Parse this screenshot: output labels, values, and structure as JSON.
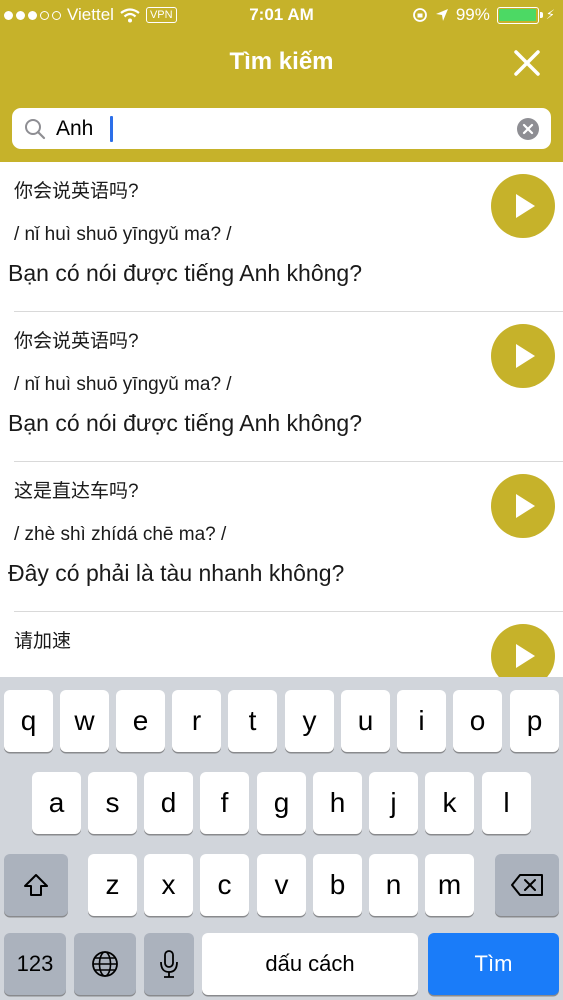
{
  "status_bar": {
    "carrier": "Viettel",
    "vpn": "VPN",
    "time": "7:01 AM",
    "battery": "99%",
    "battery_level": 0.99,
    "icons": [
      "signal-dots",
      "wifi-icon",
      "vpn-badge",
      "orientation-lock-icon",
      "location-arrow-icon",
      "battery-icon",
      "charging-bolt-icon"
    ]
  },
  "header": {
    "title": "Tìm kiếm",
    "close_icon": "close-icon"
  },
  "search": {
    "value": "Anh",
    "search_icon": "search-icon",
    "clear_icon": "clear-icon"
  },
  "results": [
    {
      "chinese": "你会说英语吗?",
      "pinyin": "/ nǐ huì shuō yīngyǔ ma? /",
      "vietnamese": "Bạn có nói được tiếng Anh không?"
    },
    {
      "chinese": "你会说英语吗?",
      "pinyin": "/ nǐ huì shuō yīngyǔ ma? /",
      "vietnamese": "Bạn có nói được tiếng Anh không?"
    },
    {
      "chinese": "这是直达车吗?",
      "pinyin": "/ zhè shì zhídá chē ma? /",
      "vietnamese": "Đây có phải là tàu nhanh không?"
    },
    {
      "chinese": "请加速",
      "pinyin": "",
      "vietnamese": ""
    }
  ],
  "keyboard": {
    "row1": [
      "q",
      "w",
      "e",
      "r",
      "t",
      "y",
      "u",
      "i",
      "o",
      "p"
    ],
    "row2": [
      "a",
      "s",
      "d",
      "f",
      "g",
      "h",
      "j",
      "k",
      "l"
    ],
    "row3": [
      "z",
      "x",
      "c",
      "v",
      "b",
      "n",
      "m"
    ],
    "numbers_key": "123",
    "space_key": "dấu cách",
    "go_key": "Tìm",
    "icons": [
      "shift-icon",
      "delete-icon",
      "globe-icon",
      "microphone-icon"
    ]
  },
  "colors": {
    "accent": "#c6b22a",
    "caret": "#2c6fe9",
    "go_key": "#1a7cf9",
    "battery_fill": "#4cd964"
  }
}
